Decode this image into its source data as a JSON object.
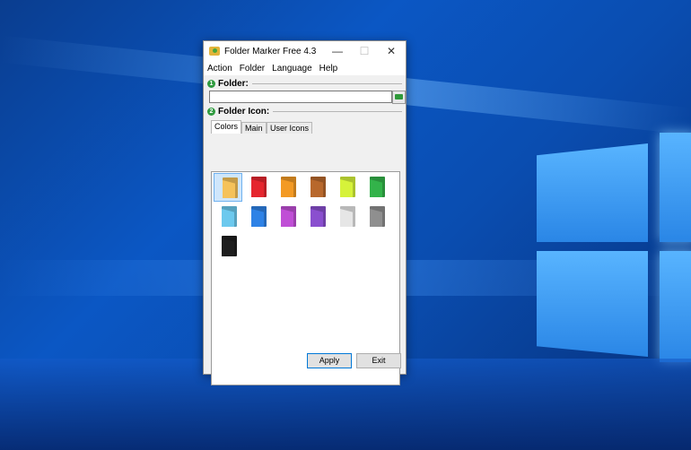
{
  "window": {
    "title": "Folder Marker Free 4.3",
    "minimize": "—",
    "maximize": "☐",
    "close": "✕"
  },
  "menu": [
    "Action",
    "Folder",
    "Language",
    "Help"
  ],
  "sections": {
    "folder": {
      "number": "1",
      "label": "Folder:"
    },
    "icon": {
      "number": "2",
      "label": "Folder Icon:"
    }
  },
  "folder_input": {
    "value": ""
  },
  "tabs": [
    "Colors",
    "Main",
    "User Icons"
  ],
  "active_tab": "Colors",
  "icons": [
    {
      "color": "#f5c25a",
      "selected": true
    },
    {
      "color": "#e5262e"
    },
    {
      "color": "#f39a24"
    },
    {
      "color": "#b8682c"
    },
    {
      "color": "#d6f23a"
    },
    {
      "color": "#33b34a"
    },
    {
      "color": "#6cc9ee"
    },
    {
      "color": "#2e82e6"
    },
    {
      "color": "#c04fd6"
    },
    {
      "color": "#8a4fcf"
    },
    {
      "color": "#e6e6e6"
    },
    {
      "color": "#8f8f8f"
    },
    {
      "color": "#1e1e1e"
    }
  ],
  "buttons": {
    "apply": "Apply",
    "exit": "Exit"
  }
}
